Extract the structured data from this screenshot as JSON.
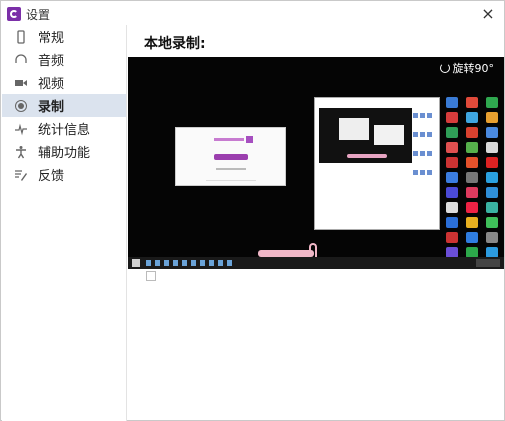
{
  "window": {
    "title": "设置",
    "close_glyph": "×"
  },
  "sidebar": {
    "items": [
      {
        "label": "常规",
        "icon": "phone-icon"
      },
      {
        "label": "音频",
        "icon": "headphones-icon"
      },
      {
        "label": "视频",
        "icon": "camera-icon"
      },
      {
        "label": "录制",
        "icon": "record-icon",
        "active": true
      },
      {
        "label": "统计信息",
        "icon": "stats-icon"
      },
      {
        "label": "辅助功能",
        "icon": "accessibility-icon"
      },
      {
        "label": "反馈",
        "icon": "feedback-icon"
      }
    ]
  },
  "main": {
    "page_title": "本地录制:",
    "preview": {
      "rotate_label": "旋转90°"
    }
  },
  "colors": {
    "accent": "#7b2fa8",
    "active_item_bg": "#dbe3ee",
    "preview_bg": "#050505"
  }
}
